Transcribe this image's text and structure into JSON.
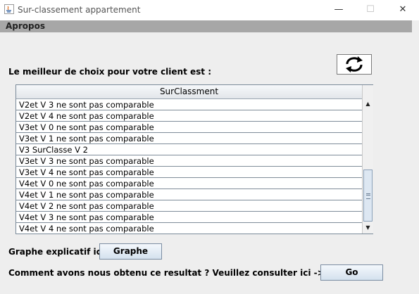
{
  "window": {
    "title": "Sur-classement appartement",
    "app_icon": "java-icon",
    "controls": [
      "minimize-icon",
      "maximize-icon",
      "close-icon"
    ],
    "minimize_glyph": "—",
    "maximize_glyph": "☐",
    "close_glyph": "✕"
  },
  "menu": {
    "apropos": "Apropos"
  },
  "main": {
    "result_label": "Le meilleur de choix pour votre client est :",
    "refresh_icon": "refresh-icon"
  },
  "table": {
    "header": "SurClassment",
    "rows": [
      "V2et V 3 ne sont pas comparable",
      "V2et V 4 ne sont pas comparable",
      "V3et V 0 ne sont pas comparable",
      "V3et V 1 ne sont pas comparable",
      "V3  SurClasse V 2",
      "V3et V 3 ne sont pas comparable",
      "V3et V 4 ne sont pas comparable",
      "V4et V 0 ne sont pas comparable",
      "V4et V 1 ne sont pas comparable",
      "V4et V 2 ne sont pas comparable",
      "V4et V 3 ne sont pas comparable",
      "V4et V 4 ne sont pas comparable"
    ]
  },
  "graph": {
    "label": "Graphe explicatif ici ->",
    "button": "Graphe"
  },
  "explain": {
    "label": "Comment avons nous obtenu ce resultat ? Veuillez consulter ici ->",
    "button": "Go"
  }
}
